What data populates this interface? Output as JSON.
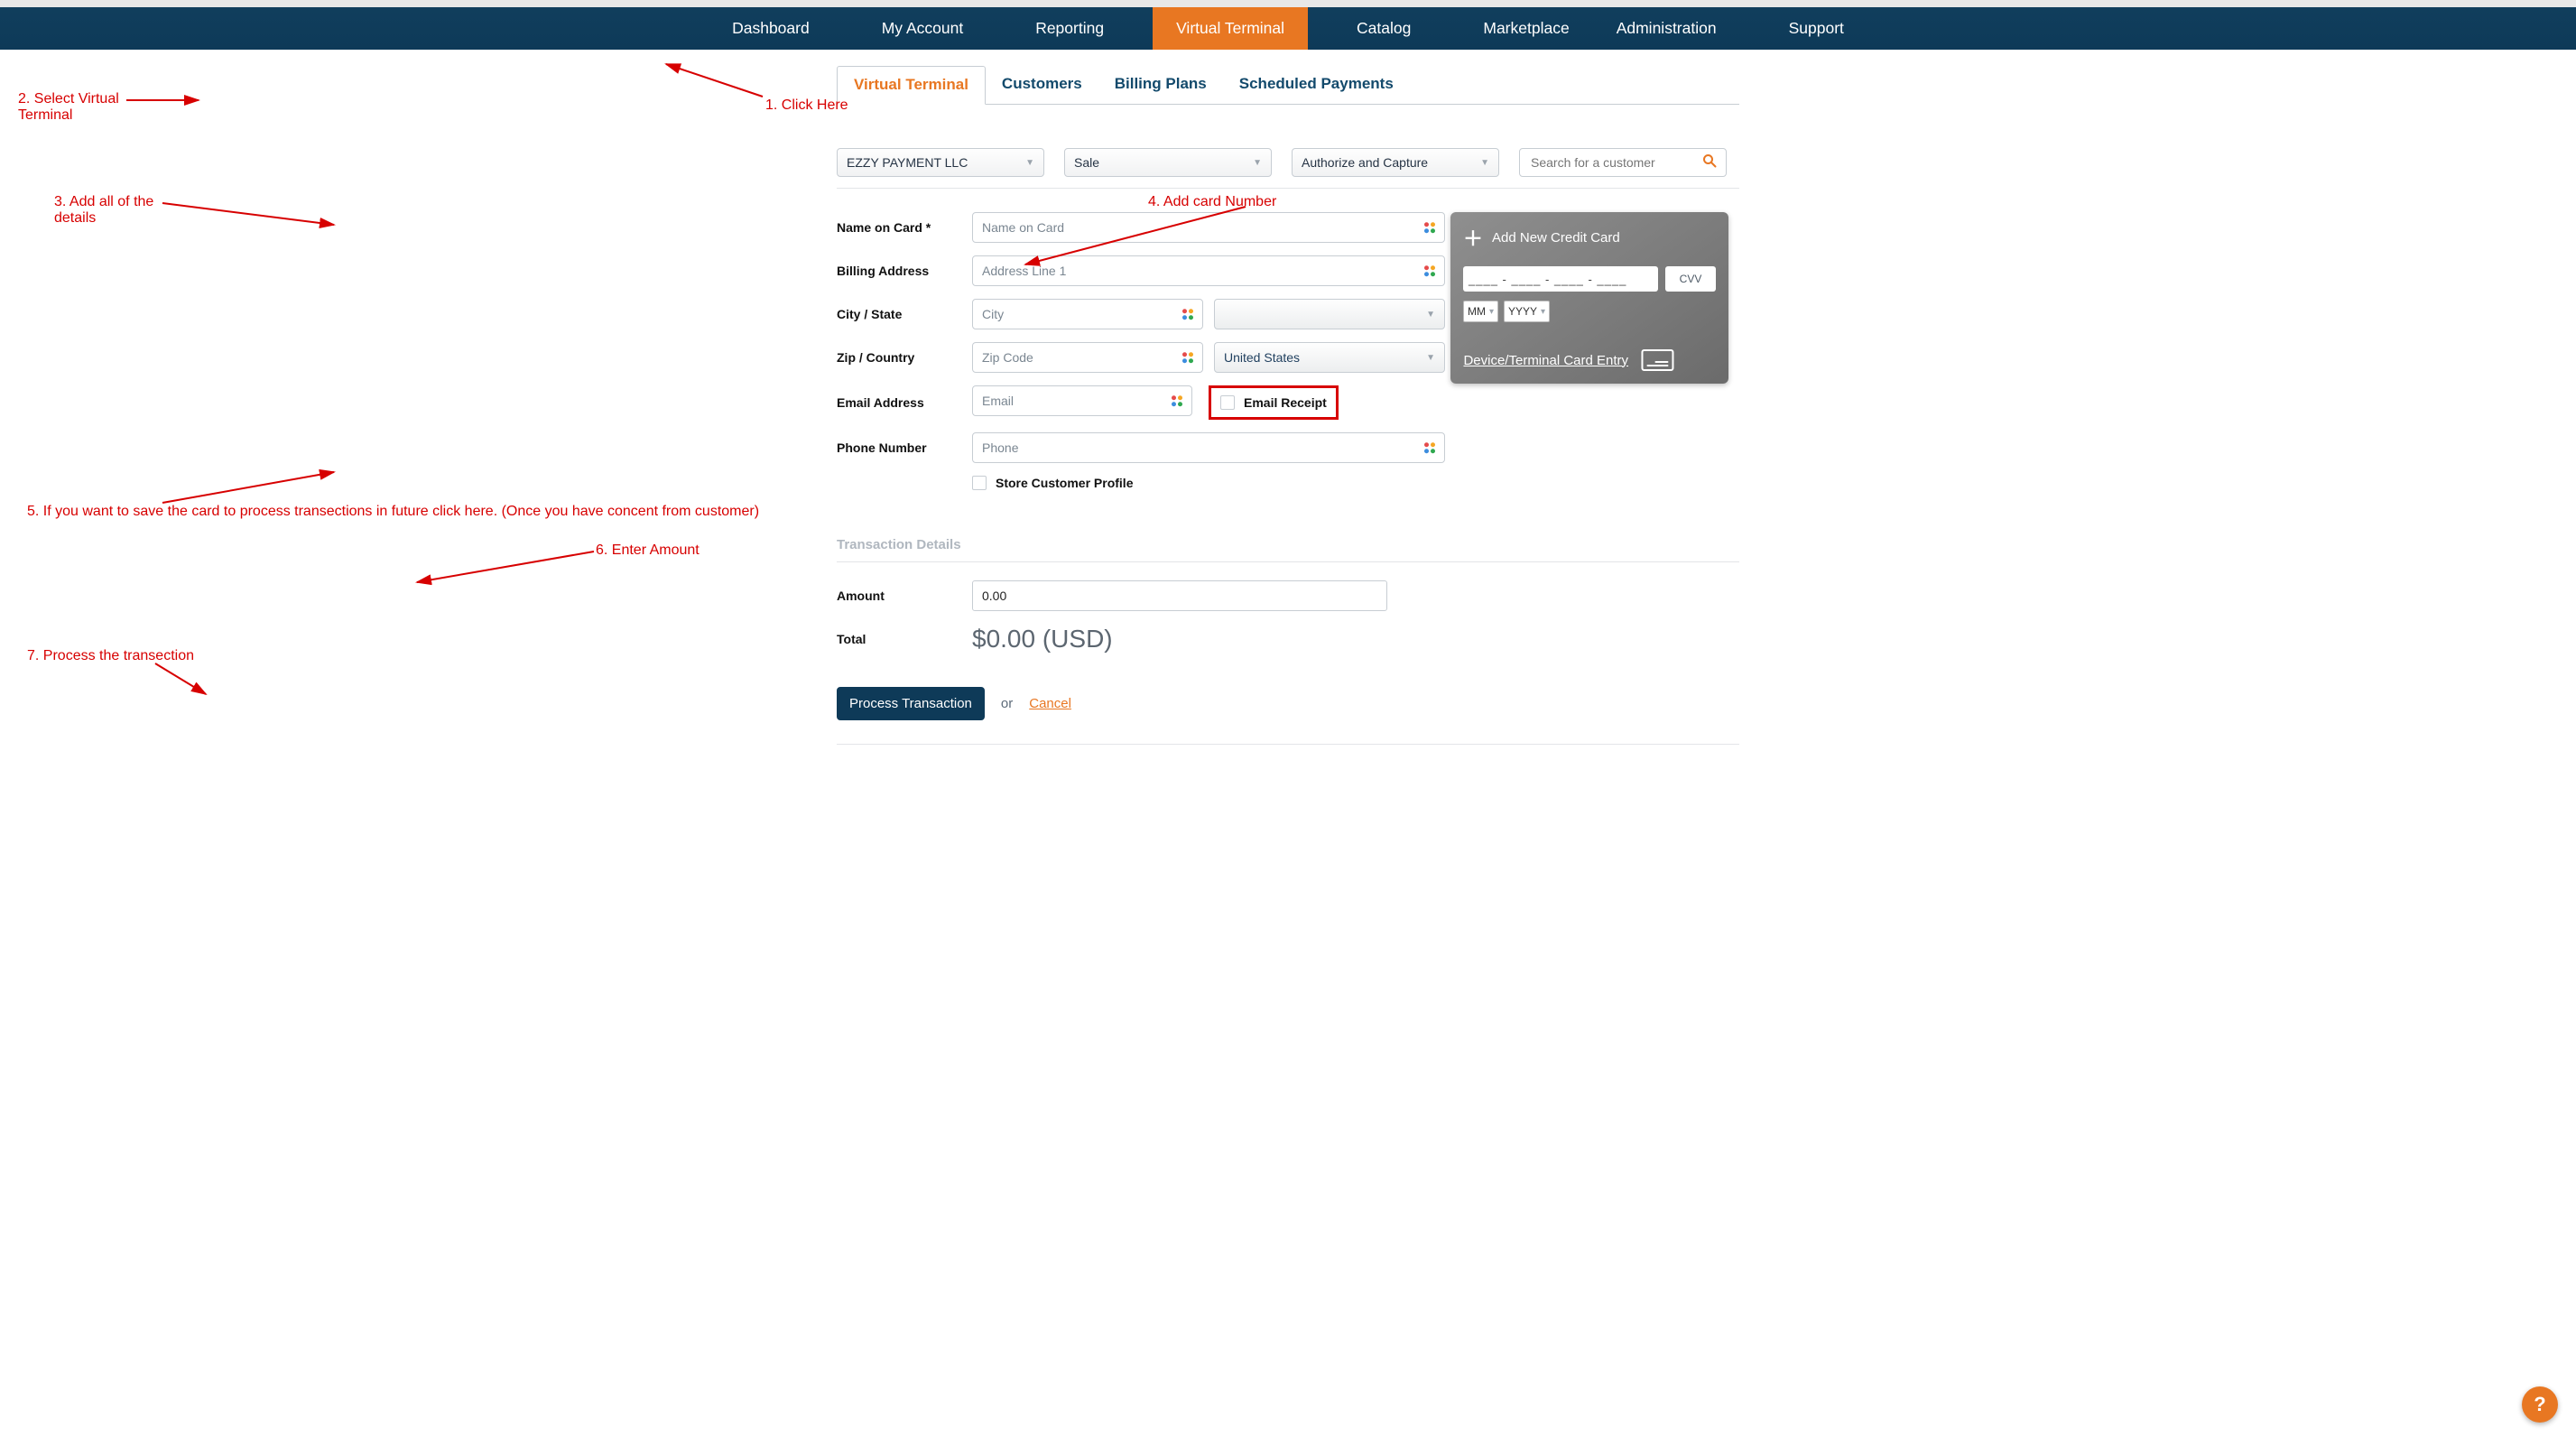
{
  "nav": {
    "items": [
      "Dashboard",
      "My Account",
      "Reporting",
      "Virtual Terminal",
      "Catalog",
      "Marketplace",
      "Administration",
      "Support"
    ],
    "active": "Virtual Terminal"
  },
  "tabs": {
    "items": [
      "Virtual Terminal",
      "Customers",
      "Billing Plans",
      "Scheduled Payments"
    ],
    "active": "Virtual Terminal"
  },
  "filters": {
    "merchant": "EZZY PAYMENT LLC",
    "txn_type": "Sale",
    "mode": "Authorize and Capture",
    "search_placeholder": "Search for a customer"
  },
  "form": {
    "labels": {
      "name": "Name on Card *",
      "billing": "Billing Address",
      "citystate": "City / State",
      "zipcountry": "Zip / Country",
      "email": "Email Address",
      "phone": "Phone Number",
      "store": "Store Customer Profile",
      "email_receipt": "Email Receipt"
    },
    "placeholders": {
      "name": "Name on Card",
      "addr": "Address Line 1",
      "city": "City",
      "zip": "Zip Code",
      "email": "Email",
      "phone": "Phone"
    },
    "country": "United States"
  },
  "card": {
    "title": "Add New Credit Card",
    "number_mask": "____ - ____ - ____ - ____",
    "cvv": "CVV",
    "mm": "MM",
    "yyyy": "YYYY",
    "device_link": "Device/Terminal Card Entry"
  },
  "tx": {
    "section": "Transaction Details",
    "amount_label": "Amount",
    "amount_value": "0.00",
    "total_label": "Total",
    "total_value": "$0.00 (USD)",
    "process": "Process Transaction",
    "or": "or",
    "cancel": "Cancel"
  },
  "annotations": {
    "a1": "1. Click Here",
    "a2": "2. Select Virtual Terminal",
    "a3": "3. Add all of the details",
    "a4": "4. Add card Number",
    "a5": "5. If you want to save the card to process transections in future click here. (Once you have concent from customer)",
    "a6": "6. Enter Amount",
    "a7": "7. Process the transection"
  },
  "help": "?"
}
